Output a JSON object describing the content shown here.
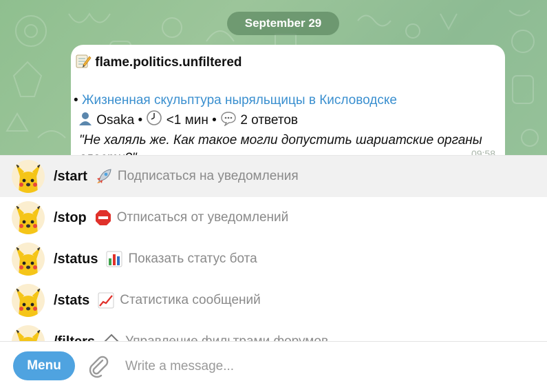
{
  "chat": {
    "date_separator": "September 29",
    "message": {
      "channel_title": "flame.politics.unfiltered",
      "bullet": "•",
      "link_text": "Жизненная скульптура ныряльщицы в Кисловодске",
      "author": "Osaka",
      "sep1": "•",
      "duration": "<1 мин",
      "sep2": "•",
      "replies": "2 ответов",
      "quote": "\"Не халяль же. Как такое могли допустить шариатские органы власти?\"",
      "time": "09:58"
    }
  },
  "commands": [
    {
      "name": "/start",
      "icon": "rocket-icon",
      "description": "Подписаться на уведомления"
    },
    {
      "name": "/stop",
      "icon": "stop-sign-icon",
      "description": "Отписаться от уведомлений"
    },
    {
      "name": "/status",
      "icon": "bar-chart-icon",
      "description": "Показать статус бота"
    },
    {
      "name": "/stats",
      "icon": "chart-increasing-icon",
      "description": "Статистика сообщений"
    },
    {
      "name": "/filters",
      "icon": "filter-icon",
      "description": "Управление фильтрами форумов"
    }
  ],
  "composer": {
    "menu_label": "Menu",
    "placeholder": "Write a message..."
  },
  "colors": {
    "accent": "#4fa3e0",
    "link": "#3a8fcf",
    "chat_background": "#8fbf8f"
  }
}
